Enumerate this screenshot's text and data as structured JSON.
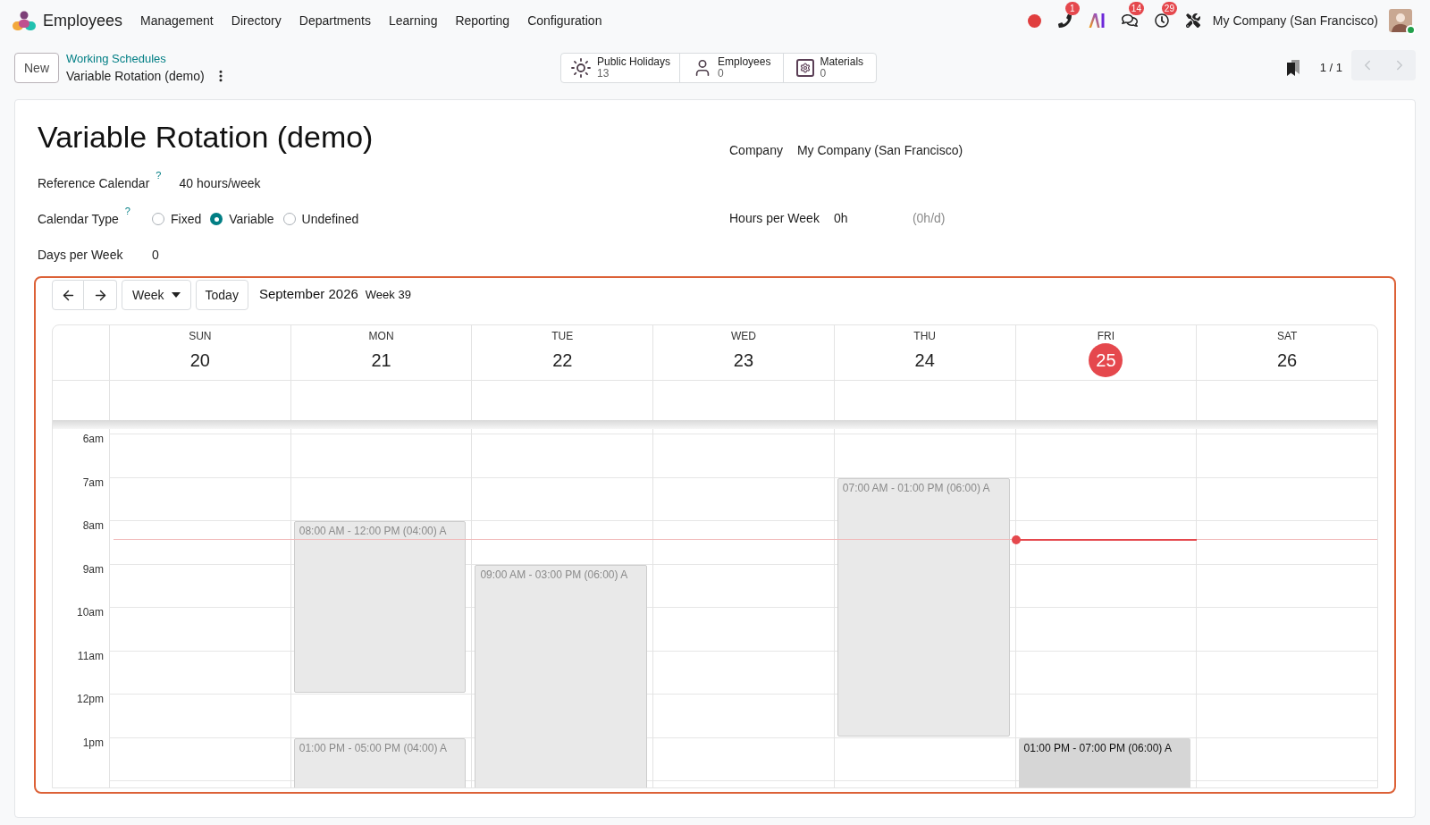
{
  "navbar": {
    "app_name": "Employees",
    "menus": [
      "Management",
      "Directory",
      "Departments",
      "Learning",
      "Reporting",
      "Configuration"
    ],
    "systray": [
      {
        "kind": "record"
      },
      {
        "kind": "phone",
        "badge": "1"
      },
      {
        "kind": "ai"
      },
      {
        "kind": "chat",
        "badge": "14"
      },
      {
        "kind": "clock",
        "badge": "29"
      },
      {
        "kind": "tools"
      }
    ],
    "company": "My Company (San Francisco)",
    "user": {
      "online": true
    }
  },
  "control_panel": {
    "new_button": "New",
    "breadcrumb": {
      "parent": "Working Schedules",
      "current": "Variable Rotation (demo)"
    },
    "stat_buttons": [
      {
        "kind": "sun",
        "label": "Public Holidays",
        "value": "13"
      },
      {
        "kind": "user",
        "label": "Employees",
        "value": "0"
      },
      {
        "kind": "gear",
        "label": "Materials",
        "value": "0"
      }
    ],
    "pager": {
      "value": "1 / 1",
      "previous": {
        "disabled": true
      },
      "next": {
        "disabled": true
      }
    }
  },
  "form": {
    "title": "Variable Rotation (demo)",
    "left_fields": [
      {
        "kind": "text",
        "label": "Reference Calendar",
        "help": "?",
        "value": "40 hours/week"
      },
      {
        "kind": "radio",
        "label": "Calendar Type",
        "help": "?",
        "options": [
          {
            "label": "Fixed",
            "selected": false
          },
          {
            "label": "Variable",
            "selected": true
          },
          {
            "label": "Undefined",
            "selected": false
          }
        ]
      },
      {
        "kind": "text",
        "label": "Days per Week",
        "value": "0"
      }
    ],
    "right_fields": [
      {
        "kind": "text",
        "label": "Company",
        "value": "My Company (San Francisco)"
      },
      {
        "kind": "text",
        "label": "Hours per Week",
        "value": "0h",
        "note": "(0h/d)"
      }
    ]
  },
  "calendar": {
    "view": "Week",
    "today_button": "Today",
    "period": "September 2026",
    "week": "Week 39",
    "hours": [
      {
        "label": "6am",
        "now": false
      },
      {
        "label": "7am",
        "now": false
      },
      {
        "label": "8am",
        "now": true
      },
      {
        "label": "9am",
        "now": false
      },
      {
        "label": "10am",
        "now": false
      },
      {
        "label": "11am",
        "now": false
      },
      {
        "label": "12pm",
        "now": false
      },
      {
        "label": "1pm",
        "now": false
      }
    ],
    "days": [
      {
        "name": "SUN",
        "date": "20",
        "today": false,
        "slots": [
          {
            "kind": "free"
          },
          {
            "kind": "free"
          },
          {
            "kind": "free"
          },
          {
            "kind": "free"
          },
          {
            "kind": "free"
          },
          {
            "kind": "free"
          },
          {
            "kind": "free"
          },
          {
            "kind": "free"
          }
        ]
      },
      {
        "name": "MON",
        "date": "21",
        "today": false,
        "slots": [
          {
            "kind": "free"
          },
          {
            "kind": "free"
          },
          {
            "kind": "event",
            "text": "08:00 AM - 12:00 PM (04:00) A",
            "selected": false
          },
          {
            "kind": "continued"
          },
          {
            "kind": "continued"
          },
          {
            "kind": "continued"
          },
          {
            "kind": "free"
          },
          {
            "kind": "event",
            "text": "01:00 PM - 05:00 PM (04:00) A",
            "selected": false
          }
        ]
      },
      {
        "name": "TUE",
        "date": "22",
        "today": false,
        "slots": [
          {
            "kind": "free"
          },
          {
            "kind": "free"
          },
          {
            "kind": "free"
          },
          {
            "kind": "event",
            "text": "09:00 AM - 03:00 PM (06:00) A",
            "selected": false
          },
          {
            "kind": "continued"
          },
          {
            "kind": "continued"
          },
          {
            "kind": "continued"
          },
          {
            "kind": "continued"
          }
        ]
      },
      {
        "name": "WED",
        "date": "23",
        "today": false,
        "slots": [
          {
            "kind": "free"
          },
          {
            "kind": "free"
          },
          {
            "kind": "free"
          },
          {
            "kind": "free"
          },
          {
            "kind": "free"
          },
          {
            "kind": "free"
          },
          {
            "kind": "free"
          },
          {
            "kind": "free"
          }
        ]
      },
      {
        "name": "THU",
        "date": "24",
        "today": false,
        "slots": [
          {
            "kind": "free"
          },
          {
            "kind": "event",
            "text": "07:00 AM - 01:00 PM (06:00) A",
            "selected": false
          },
          {
            "kind": "continued"
          },
          {
            "kind": "continued"
          },
          {
            "kind": "continued"
          },
          {
            "kind": "continued"
          },
          {
            "kind": "continued"
          },
          {
            "kind": "free"
          }
        ]
      },
      {
        "name": "FRI",
        "date": "25",
        "today": true,
        "slots": [
          {
            "kind": "free"
          },
          {
            "kind": "free"
          },
          {
            "kind": "free"
          },
          {
            "kind": "free"
          },
          {
            "kind": "free"
          },
          {
            "kind": "free"
          },
          {
            "kind": "free"
          },
          {
            "kind": "event",
            "text": "01:00 PM - 07:00 PM (06:00) A",
            "selected": true
          }
        ]
      },
      {
        "name": "SAT",
        "date": "26",
        "today": false,
        "slots": [
          {
            "kind": "free"
          },
          {
            "kind": "free"
          },
          {
            "kind": "free"
          },
          {
            "kind": "free"
          },
          {
            "kind": "free"
          },
          {
            "kind": "free"
          },
          {
            "kind": "free"
          },
          {
            "kind": "free"
          }
        ]
      }
    ]
  }
}
